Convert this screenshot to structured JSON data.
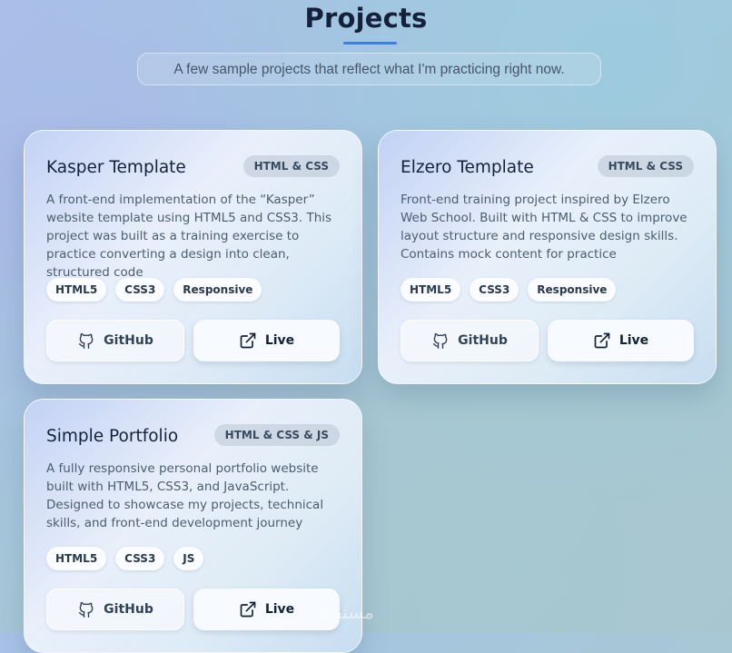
{
  "header": {
    "title": "Projects",
    "subtitle": "A few sample projects that reflect what I'm practicing right now."
  },
  "projects": [
    {
      "title": "Kasper Template",
      "badge": "HTML & CSS",
      "description": "A front-end implementation of the “Kasper” website template using HTML5 and CSS3. This project was built as a training exercise to practice converting a design into clean, structured code",
      "tags": [
        "HTML5",
        "CSS3",
        "Responsive"
      ],
      "github_label": "GitHub",
      "live_label": "Live"
    },
    {
      "title": "Elzero Template",
      "badge": "HTML & CSS",
      "description": "Front-end training project inspired by Elzero Web School. Built with HTML & CSS to improve layout structure and responsive design skills. Contains mock content for practice",
      "tags": [
        "HTML5",
        "CSS3",
        "Responsive"
      ],
      "github_label": "GitHub",
      "live_label": "Live"
    },
    {
      "title": "Simple Portfolio",
      "badge": "HTML & CSS & JS",
      "description": "A fully responsive personal portfolio website built with HTML5, CSS3, and JavaScript. Designed to showcase my projects, technical skills, and front-end development journey",
      "tags": [
        "HTML5",
        "CSS3",
        "JS"
      ],
      "github_label": "GitHub",
      "live_label": "Live"
    }
  ],
  "icons": {
    "github": "github-icon",
    "live": "external-link-icon"
  },
  "colors": {
    "accent": "#3b7fe0",
    "heading": "#13213a",
    "text": "#4c5d6e"
  },
  "watermark": "مستقل"
}
